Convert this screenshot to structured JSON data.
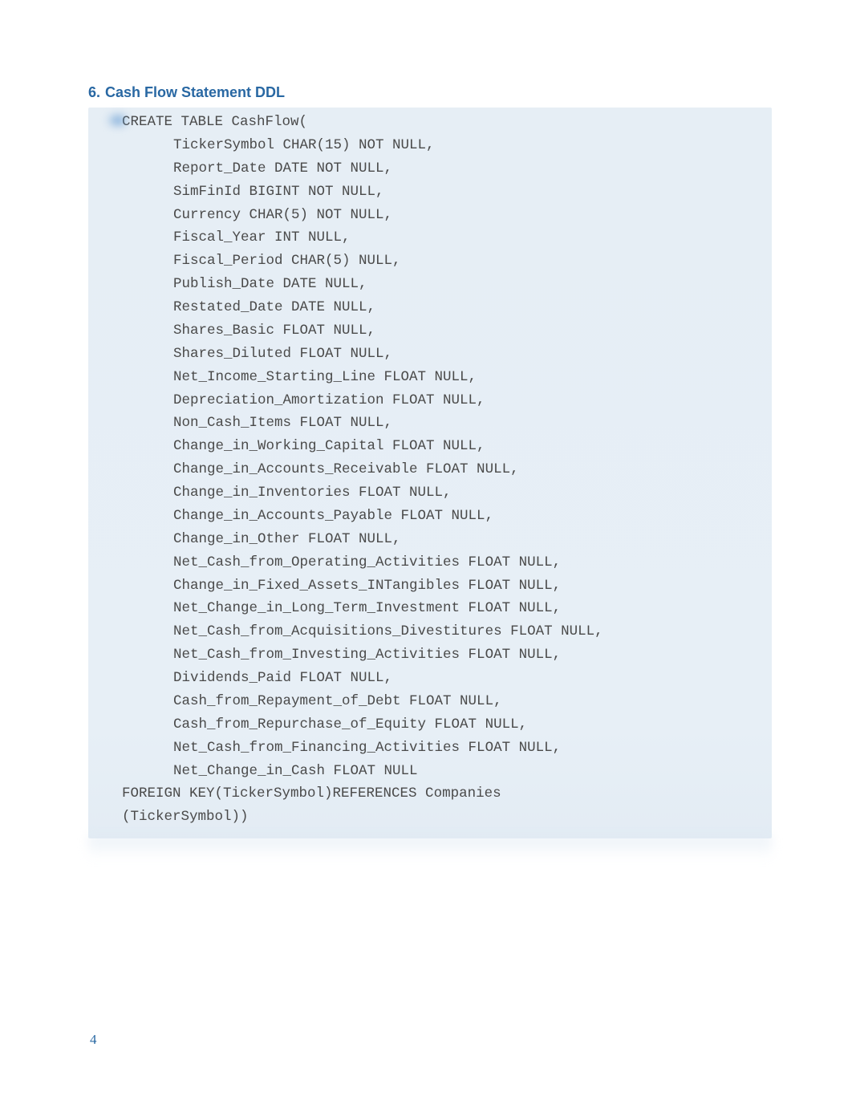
{
  "heading": {
    "number": "6.",
    "title": "Cash Flow Statement DDL"
  },
  "code": {
    "line01": "CREATE TABLE CashFlow(",
    "line02": "TickerSymbol CHAR(15) NOT NULL,",
    "line03": "Report_Date DATE NOT NULL,",
    "line04": "SimFinId BIGINT NOT NULL,",
    "line05": "Currency CHAR(5) NOT NULL,",
    "line06": "Fiscal_Year INT NULL,",
    "line07": "Fiscal_Period CHAR(5) NULL,",
    "line08": "Publish_Date DATE NULL,",
    "line09": "Restated_Date DATE NULL,",
    "line10": "Shares_Basic FLOAT NULL,",
    "line11": "Shares_Diluted FLOAT NULL,",
    "line12": "Net_Income_Starting_Line FLOAT NULL,",
    "line13": "Depreciation_Amortization FLOAT NULL,",
    "line14": "Non_Cash_Items FLOAT NULL,",
    "line15": "Change_in_Working_Capital FLOAT NULL,",
    "line16": "Change_in_Accounts_Receivable FLOAT NULL,",
    "line17": "Change_in_Inventories FLOAT NULL,",
    "line18": "Change_in_Accounts_Payable FLOAT NULL,",
    "line19": "Change_in_Other FLOAT NULL,",
    "line20": "Net_Cash_from_Operating_Activities FLOAT NULL,",
    "line21": "Change_in_Fixed_Assets_INTangibles FLOAT NULL,",
    "line22": "Net_Change_in_Long_Term_Investment FLOAT NULL,",
    "line23": "Net_Cash_from_Acquisitions_Divestitures FLOAT NULL,",
    "line24": "Net_Cash_from_Investing_Activities FLOAT NULL,",
    "line25": "Dividends_Paid FLOAT NULL,",
    "line26": "Cash_from_Repayment_of_Debt FLOAT NULL,",
    "line27": "Cash_from_Repurchase_of_Equity FLOAT NULL,",
    "line28": "Net_Cash_from_Financing_Activities FLOAT NULL,",
    "line29": "Net_Change_in_Cash FLOAT NULL",
    "line30": "FOREIGN KEY(TickerSymbol)REFERENCES Companies",
    "line31": "(TickerSymbol))"
  },
  "pageNumber": "4"
}
